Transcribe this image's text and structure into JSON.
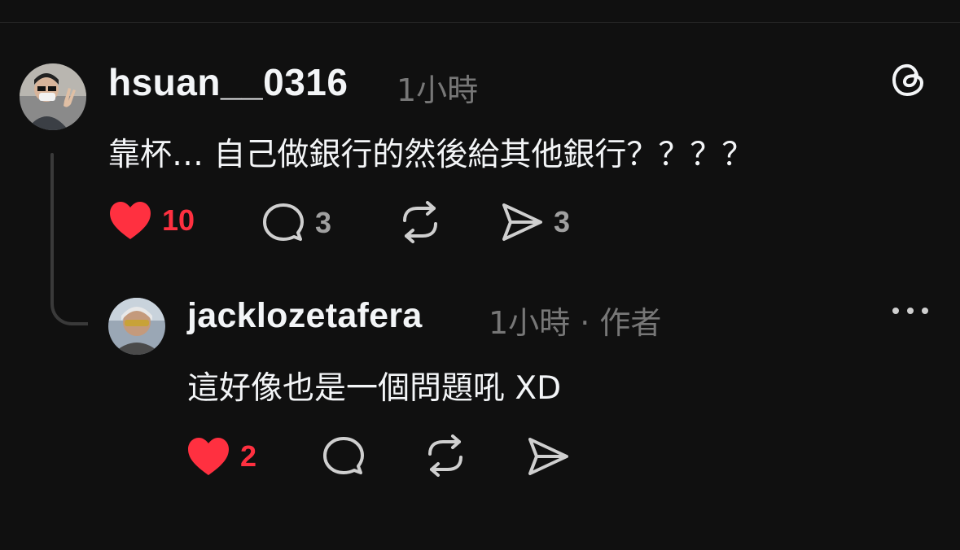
{
  "post": {
    "username": "hsuan__0316",
    "time": "1小時",
    "text": "靠杯… 自己做銀行的然後給其他銀行？？？？",
    "likes": "10",
    "comments": "3",
    "shares": "3"
  },
  "reply": {
    "username": "jacklozetafera",
    "meta": "1小時 · 作者",
    "text": "這好像也是一個問題吼 XD",
    "likes": "2"
  },
  "colors": {
    "background": "#101010",
    "like_red": "#ff3040",
    "text_primary": "#f3f5f7",
    "text_secondary": "#777777",
    "icon_grey": "#cfcfcf"
  },
  "icons": [
    "threads-logo-icon",
    "heart-filled-icon",
    "comment-icon",
    "repost-icon",
    "share-icon",
    "more-icon"
  ]
}
